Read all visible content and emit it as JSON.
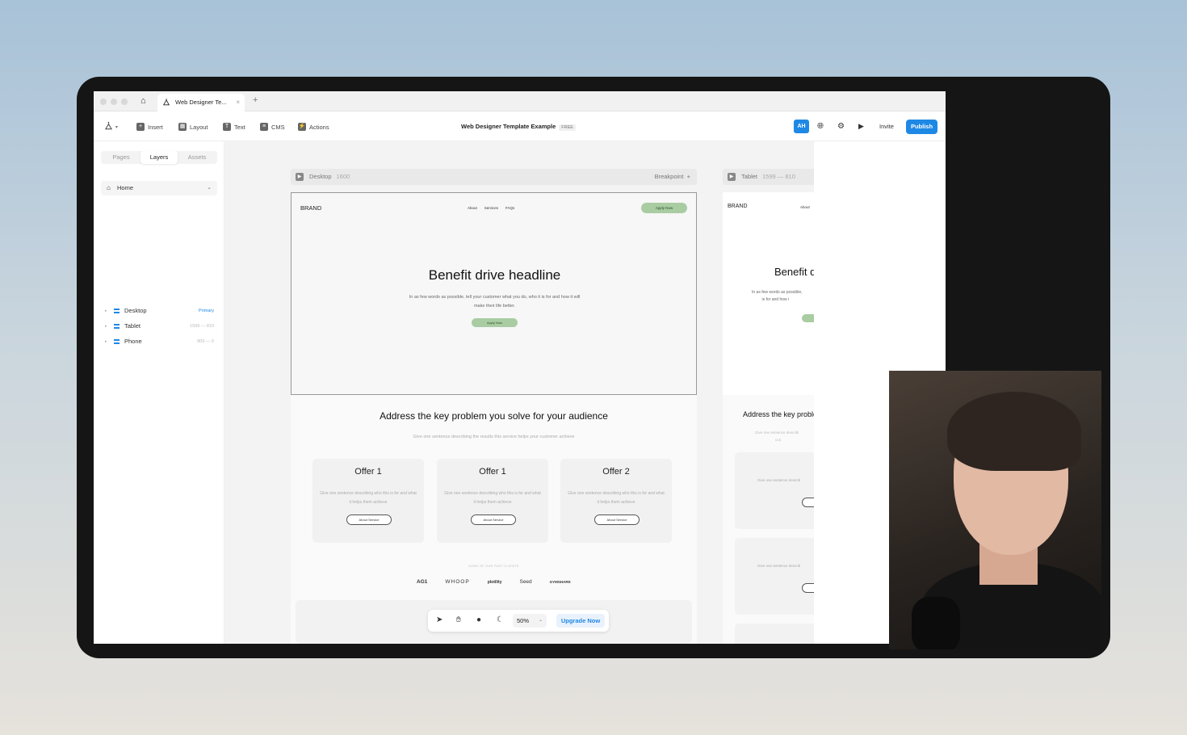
{
  "browser": {
    "tab_title": "Web Designer Te...",
    "tab_close": "×",
    "new_tab": "+"
  },
  "toolbar": {
    "insert": "Insert",
    "layout": "Layout",
    "text": "Text",
    "cms": "CMS",
    "actions": "Actions",
    "project_title": "Web Designer Template Example",
    "project_badge": "FREE",
    "avatar": "AH",
    "invite": "Invite",
    "publish": "Publish",
    "accent_color": "#1e88e5"
  },
  "left_panel": {
    "tabs": [
      "Pages",
      "Layers",
      "Assets"
    ],
    "active_tab": "Layers",
    "page_select": "Home",
    "layers": [
      {
        "name": "Desktop",
        "meta": "Primary"
      },
      {
        "name": "Tablet",
        "meta": "1599 — 810"
      },
      {
        "name": "Phone",
        "meta": "809 — 0"
      }
    ]
  },
  "canvas": {
    "desktop_bar": {
      "name": "Desktop",
      "size": "1600",
      "breakpoint": "Breakpoint",
      "add": "+"
    },
    "tablet_bar": {
      "name": "Tablet",
      "size": "1599 — 810"
    },
    "site": {
      "brand": "BRAND",
      "nav": [
        "About",
        "Services",
        "FAQs"
      ],
      "apply_button": "Apply Now",
      "headline": "Benefit drive headline",
      "subtext": "In as few words as possible, tell your customer what you do, who it is for and how it will make their life better.",
      "hero_button": "Apply Now",
      "section2_title": "Address the key problem you solve for your audience",
      "section2_sub": "Give one sentence describing the results this service helps your customer achieve",
      "offers": [
        {
          "title": "Offer 1",
          "desc": "Give one sentence describing who this is for and what it helps them achieve",
          "button": "About Service"
        },
        {
          "title": "Offer 1",
          "desc": "Give one sentence describing who this is for and what it helps them achieve",
          "button": "About Service"
        },
        {
          "title": "Offer 2",
          "desc": "Give one sentence describing who this is for and what it helps them achieve",
          "button": "About Service"
        }
      ],
      "clients_label": "SOME OF OUR PAST CLIENTS",
      "client_logos": [
        "AG1",
        "WHOOP",
        "plotility",
        "Seed",
        "GYMSHARK"
      ],
      "accent_green": "#a9cca2"
    },
    "tablet_site": {
      "brand": "BRAND",
      "nav_first": "About",
      "headline": "Benefit d",
      "sub_line1": "In as few words as possible,",
      "sub_line2": "is for and how i",
      "section2_title": "Address the key proble",
      "section2_sub1": "Give one sentence describi",
      "section2_sub2": "cus",
      "card_text": "Give one sentence describ"
    }
  },
  "bottom_toolbar": {
    "zoom": "50%",
    "upgrade": "Upgrade Now"
  }
}
